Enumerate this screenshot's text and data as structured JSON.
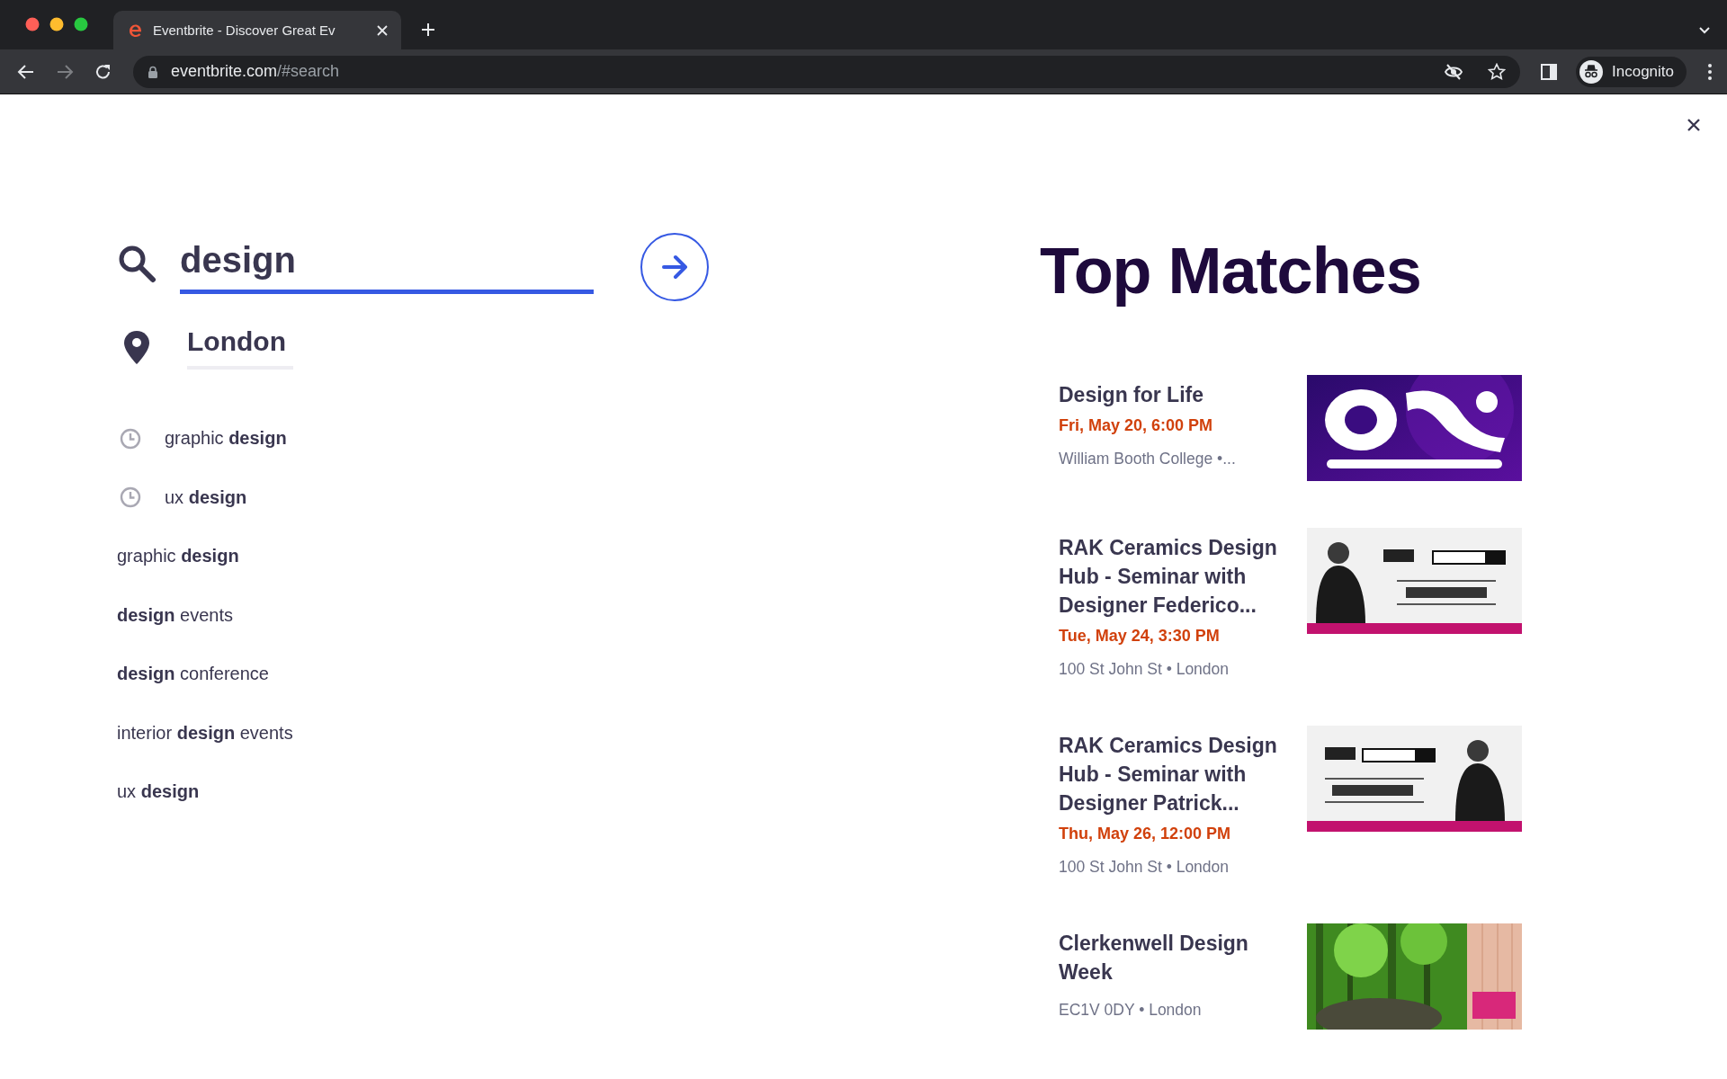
{
  "browser": {
    "tabs": [
      {
        "title": "Eventbrite - Discover Great Ev",
        "selected": true
      }
    ],
    "address_bar": {
      "domain": "eventbrite.com",
      "path": "/#search"
    },
    "profile": {
      "label": "Incognito"
    }
  },
  "search": {
    "query": "design",
    "location": "London"
  },
  "suggestions": [
    {
      "kind": "recent",
      "text": "graphic **design**"
    },
    {
      "kind": "recent",
      "text": "ux **design**"
    },
    {
      "kind": "query",
      "text": "graphic **design**"
    },
    {
      "kind": "query",
      "text": "**design** events"
    },
    {
      "kind": "query",
      "text": "**design** conference"
    },
    {
      "kind": "query",
      "text": "interior **design** events"
    },
    {
      "kind": "query",
      "text": "ux **design**"
    }
  ],
  "top_matches": {
    "title": "Top Matches",
    "events": [
      {
        "title": "Design for Life",
        "date": "Fri, May 20, 6:00 PM",
        "venue": "William Booth College •..."
      },
      {
        "title": "RAK Ceramics Design Hub - Seminar with Designer Federico...",
        "date": "Tue, May 24, 3:30 PM",
        "venue": "100 St John St • London"
      },
      {
        "title": "RAK Ceramics Design Hub - Seminar with Designer Patrick...",
        "date": "Thu, May 26, 12:00 PM",
        "venue": "100 St John St • London"
      },
      {
        "title": "Clerkenwell Design Week",
        "venue": "EC1V 0DY • London"
      }
    ]
  }
}
